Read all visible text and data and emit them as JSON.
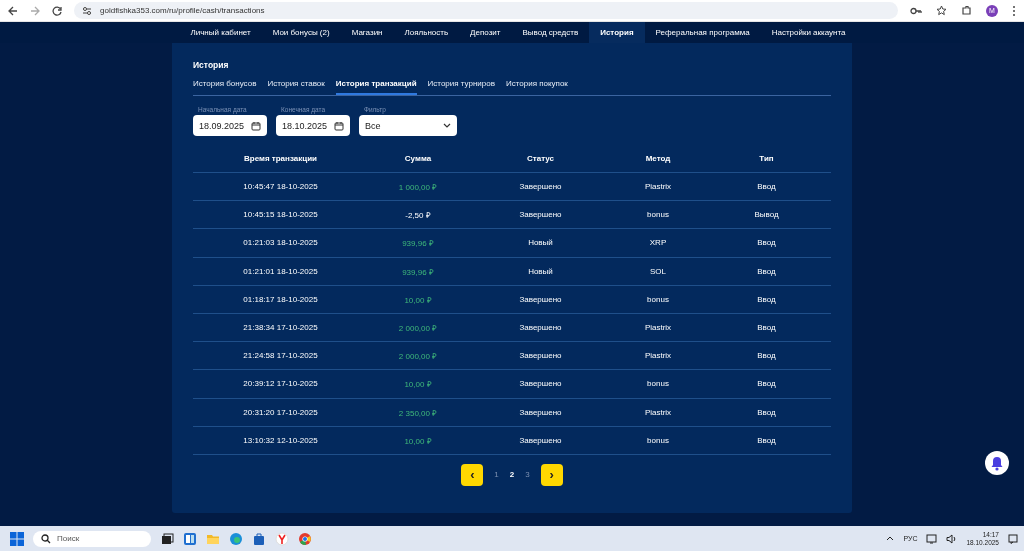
{
  "browser": {
    "url": "goldfishka353.com/ru/profile/cash/transactions",
    "profile": "M"
  },
  "nav": [
    {
      "label": "Личный кабинет",
      "selected": false
    },
    {
      "label": "Мои бонусы  (2)",
      "selected": false
    },
    {
      "label": "Магазин",
      "selected": false
    },
    {
      "label": "Лояльность",
      "selected": false
    },
    {
      "label": "Депозит",
      "selected": false
    },
    {
      "label": "Вывод средств",
      "selected": false
    },
    {
      "label": "История",
      "selected": true
    },
    {
      "label": "Реферальная программа",
      "selected": false
    },
    {
      "label": "Настройки аккаунта",
      "selected": false
    }
  ],
  "panel": {
    "title": "История"
  },
  "tabs": [
    {
      "label": "История бонусов",
      "selected": false
    },
    {
      "label": "История ставок",
      "selected": false
    },
    {
      "label": "История транзакций",
      "selected": true
    },
    {
      "label": "История турниров",
      "selected": false
    },
    {
      "label": "История покупок",
      "selected": false
    }
  ],
  "filters": [
    {
      "kind": "date",
      "label": "Начальная дата",
      "value": "18.09.2025"
    },
    {
      "kind": "date",
      "label": "Конечная дата",
      "value": "18.10.2025"
    },
    {
      "kind": "select",
      "label": "Фильтр",
      "value": "Все"
    }
  ],
  "table": {
    "columns": [
      "Время транзакции",
      "Сумма",
      "Статус",
      "Метод",
      "Тип"
    ],
    "rows": [
      {
        "time": "10:45:47 18-10-2025",
        "amount": "1 000,00 ₽",
        "kind": "credit",
        "status": "Завершено",
        "method": "Piastrix",
        "type": "Ввод"
      },
      {
        "time": "10:45:15 18-10-2025",
        "amount": "-2,50 ₽",
        "kind": "debit",
        "status": "Завершено",
        "method": "bonus",
        "type": "Вывод"
      },
      {
        "time": "01:21:03 18-10-2025",
        "amount": "939,96 ₽",
        "kind": "credit",
        "status": "Новый",
        "method": "XRP",
        "type": "Ввод"
      },
      {
        "time": "01:21:01 18-10-2025",
        "amount": "939,96 ₽",
        "kind": "credit",
        "status": "Новый",
        "method": "SOL",
        "type": "Ввод"
      },
      {
        "time": "01:18:17 18-10-2025",
        "amount": "10,00 ₽",
        "kind": "credit",
        "status": "Завершено",
        "method": "bonus",
        "type": "Ввод"
      },
      {
        "time": "21:38:34 17-10-2025",
        "amount": "2 000,00 ₽",
        "kind": "credit",
        "status": "Завершено",
        "method": "Piastrix",
        "type": "Ввод"
      },
      {
        "time": "21:24:58 17-10-2025",
        "amount": "2 000,00 ₽",
        "kind": "credit",
        "status": "Завершено",
        "method": "Piastrix",
        "type": "Ввод"
      },
      {
        "time": "20:39:12 17-10-2025",
        "amount": "10,00 ₽",
        "kind": "credit",
        "status": "Завершено",
        "method": "bonus",
        "type": "Ввод"
      },
      {
        "time": "20:31:20 17-10-2025",
        "amount": "2 350,00 ₽",
        "kind": "credit",
        "status": "Завершено",
        "method": "Piastrix",
        "type": "Ввод"
      },
      {
        "time": "13:10:32 12-10-2025",
        "amount": "10,00 ₽",
        "kind": "credit",
        "status": "Завершено",
        "method": "bonus",
        "type": "Ввод"
      }
    ]
  },
  "pagination": {
    "prev": "‹",
    "next": "›",
    "pages": [
      {
        "label": "1",
        "selected": false
      },
      {
        "label": "2",
        "selected": true
      },
      {
        "label": "3",
        "selected": false
      }
    ]
  },
  "taskbar": {
    "search_placeholder": "Поиск",
    "language": "РУС",
    "time": "14:17",
    "date": "18.10.2025"
  }
}
